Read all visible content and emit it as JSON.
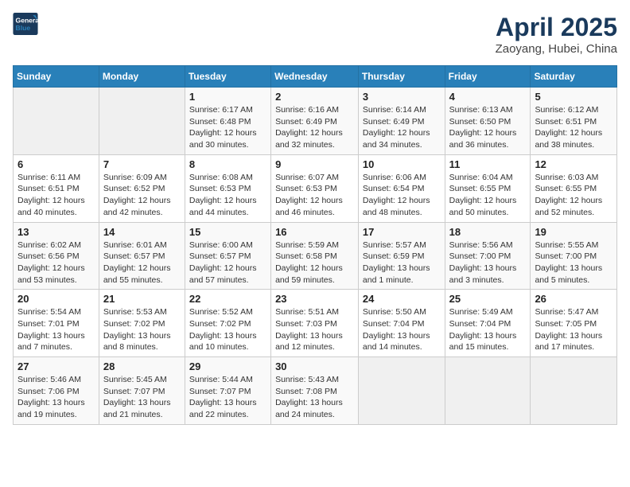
{
  "header": {
    "logo_line1": "General",
    "logo_line2": "Blue",
    "title": "April 2025",
    "subtitle": "Zaoyang, Hubei, China"
  },
  "days_of_week": [
    "Sunday",
    "Monday",
    "Tuesday",
    "Wednesday",
    "Thursday",
    "Friday",
    "Saturday"
  ],
  "weeks": [
    [
      {
        "day": "",
        "empty": true
      },
      {
        "day": "",
        "empty": true
      },
      {
        "day": "1",
        "sunrise": "Sunrise: 6:17 AM",
        "sunset": "Sunset: 6:48 PM",
        "daylight": "Daylight: 12 hours and 30 minutes."
      },
      {
        "day": "2",
        "sunrise": "Sunrise: 6:16 AM",
        "sunset": "Sunset: 6:49 PM",
        "daylight": "Daylight: 12 hours and 32 minutes."
      },
      {
        "day": "3",
        "sunrise": "Sunrise: 6:14 AM",
        "sunset": "Sunset: 6:49 PM",
        "daylight": "Daylight: 12 hours and 34 minutes."
      },
      {
        "day": "4",
        "sunrise": "Sunrise: 6:13 AM",
        "sunset": "Sunset: 6:50 PM",
        "daylight": "Daylight: 12 hours and 36 minutes."
      },
      {
        "day": "5",
        "sunrise": "Sunrise: 6:12 AM",
        "sunset": "Sunset: 6:51 PM",
        "daylight": "Daylight: 12 hours and 38 minutes."
      }
    ],
    [
      {
        "day": "6",
        "sunrise": "Sunrise: 6:11 AM",
        "sunset": "Sunset: 6:51 PM",
        "daylight": "Daylight: 12 hours and 40 minutes."
      },
      {
        "day": "7",
        "sunrise": "Sunrise: 6:09 AM",
        "sunset": "Sunset: 6:52 PM",
        "daylight": "Daylight: 12 hours and 42 minutes."
      },
      {
        "day": "8",
        "sunrise": "Sunrise: 6:08 AM",
        "sunset": "Sunset: 6:53 PM",
        "daylight": "Daylight: 12 hours and 44 minutes."
      },
      {
        "day": "9",
        "sunrise": "Sunrise: 6:07 AM",
        "sunset": "Sunset: 6:53 PM",
        "daylight": "Daylight: 12 hours and 46 minutes."
      },
      {
        "day": "10",
        "sunrise": "Sunrise: 6:06 AM",
        "sunset": "Sunset: 6:54 PM",
        "daylight": "Daylight: 12 hours and 48 minutes."
      },
      {
        "day": "11",
        "sunrise": "Sunrise: 6:04 AM",
        "sunset": "Sunset: 6:55 PM",
        "daylight": "Daylight: 12 hours and 50 minutes."
      },
      {
        "day": "12",
        "sunrise": "Sunrise: 6:03 AM",
        "sunset": "Sunset: 6:55 PM",
        "daylight": "Daylight: 12 hours and 52 minutes."
      }
    ],
    [
      {
        "day": "13",
        "sunrise": "Sunrise: 6:02 AM",
        "sunset": "Sunset: 6:56 PM",
        "daylight": "Daylight: 12 hours and 53 minutes."
      },
      {
        "day": "14",
        "sunrise": "Sunrise: 6:01 AM",
        "sunset": "Sunset: 6:57 PM",
        "daylight": "Daylight: 12 hours and 55 minutes."
      },
      {
        "day": "15",
        "sunrise": "Sunrise: 6:00 AM",
        "sunset": "Sunset: 6:57 PM",
        "daylight": "Daylight: 12 hours and 57 minutes."
      },
      {
        "day": "16",
        "sunrise": "Sunrise: 5:59 AM",
        "sunset": "Sunset: 6:58 PM",
        "daylight": "Daylight: 12 hours and 59 minutes."
      },
      {
        "day": "17",
        "sunrise": "Sunrise: 5:57 AM",
        "sunset": "Sunset: 6:59 PM",
        "daylight": "Daylight: 13 hours and 1 minute."
      },
      {
        "day": "18",
        "sunrise": "Sunrise: 5:56 AM",
        "sunset": "Sunset: 7:00 PM",
        "daylight": "Daylight: 13 hours and 3 minutes."
      },
      {
        "day": "19",
        "sunrise": "Sunrise: 5:55 AM",
        "sunset": "Sunset: 7:00 PM",
        "daylight": "Daylight: 13 hours and 5 minutes."
      }
    ],
    [
      {
        "day": "20",
        "sunrise": "Sunrise: 5:54 AM",
        "sunset": "Sunset: 7:01 PM",
        "daylight": "Daylight: 13 hours and 7 minutes."
      },
      {
        "day": "21",
        "sunrise": "Sunrise: 5:53 AM",
        "sunset": "Sunset: 7:02 PM",
        "daylight": "Daylight: 13 hours and 8 minutes."
      },
      {
        "day": "22",
        "sunrise": "Sunrise: 5:52 AM",
        "sunset": "Sunset: 7:02 PM",
        "daylight": "Daylight: 13 hours and 10 minutes."
      },
      {
        "day": "23",
        "sunrise": "Sunrise: 5:51 AM",
        "sunset": "Sunset: 7:03 PM",
        "daylight": "Daylight: 13 hours and 12 minutes."
      },
      {
        "day": "24",
        "sunrise": "Sunrise: 5:50 AM",
        "sunset": "Sunset: 7:04 PM",
        "daylight": "Daylight: 13 hours and 14 minutes."
      },
      {
        "day": "25",
        "sunrise": "Sunrise: 5:49 AM",
        "sunset": "Sunset: 7:04 PM",
        "daylight": "Daylight: 13 hours and 15 minutes."
      },
      {
        "day": "26",
        "sunrise": "Sunrise: 5:47 AM",
        "sunset": "Sunset: 7:05 PM",
        "daylight": "Daylight: 13 hours and 17 minutes."
      }
    ],
    [
      {
        "day": "27",
        "sunrise": "Sunrise: 5:46 AM",
        "sunset": "Sunset: 7:06 PM",
        "daylight": "Daylight: 13 hours and 19 minutes."
      },
      {
        "day": "28",
        "sunrise": "Sunrise: 5:45 AM",
        "sunset": "Sunset: 7:07 PM",
        "daylight": "Daylight: 13 hours and 21 minutes."
      },
      {
        "day": "29",
        "sunrise": "Sunrise: 5:44 AM",
        "sunset": "Sunset: 7:07 PM",
        "daylight": "Daylight: 13 hours and 22 minutes."
      },
      {
        "day": "30",
        "sunrise": "Sunrise: 5:43 AM",
        "sunset": "Sunset: 7:08 PM",
        "daylight": "Daylight: 13 hours and 24 minutes."
      },
      {
        "day": "",
        "empty": true
      },
      {
        "day": "",
        "empty": true
      },
      {
        "day": "",
        "empty": true
      }
    ]
  ]
}
